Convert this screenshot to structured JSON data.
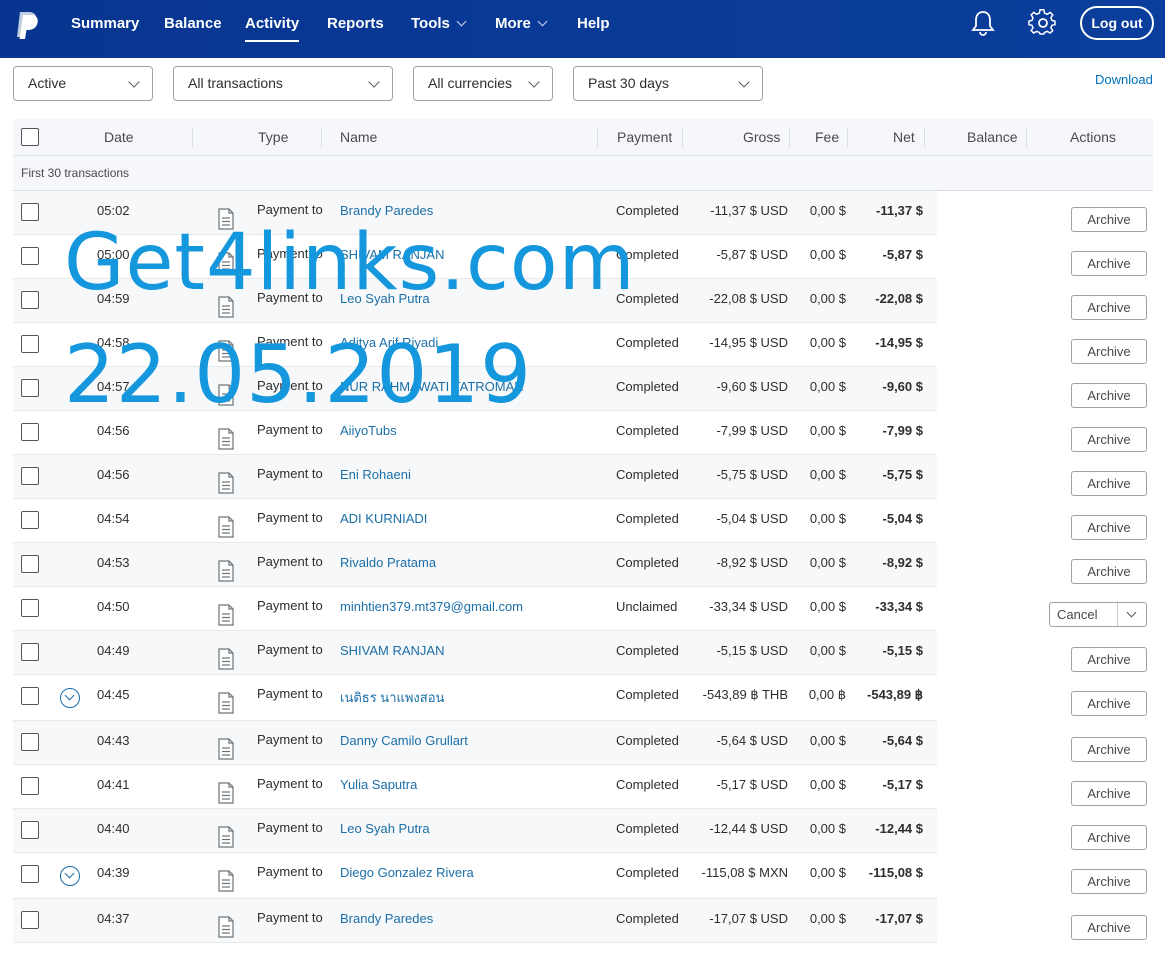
{
  "nav": {
    "items": [
      "Summary",
      "Balance",
      "Activity",
      "Reports",
      "Tools",
      "More",
      "Help"
    ],
    "active": "Activity",
    "logout_label": "Log out",
    "bell_icon": "bell-icon",
    "settings_icon": "gear-icon"
  },
  "filters": {
    "status": "Active",
    "type": "All transactions",
    "currency": "All currencies",
    "period": "Past 30 days",
    "download_label": "Download"
  },
  "table": {
    "headers": {
      "date": "Date",
      "type": "Type",
      "name": "Name",
      "payment": "Payment",
      "gross": "Gross",
      "fee": "Fee",
      "net": "Net",
      "balance": "Balance",
      "actions": "Actions"
    },
    "group_label": "First 30 transactions",
    "rows": [
      {
        "time": "05:02",
        "type": "Payment to",
        "name": "Brandy Paredes",
        "payment": "Completed",
        "gross": "-11,37 $ USD",
        "fee": "0,00 $",
        "net": "-11,37 $",
        "action": "Archive",
        "expand": false
      },
      {
        "time": "05:00",
        "type": "Payment to",
        "name": "SHIVAM RANJAN",
        "payment": "Completed",
        "gross": "-5,87 $ USD",
        "fee": "0,00 $",
        "net": "-5,87 $",
        "action": "Archive",
        "expand": false
      },
      {
        "time": "04:59",
        "type": "Payment to",
        "name": "Leo Syah Putra",
        "payment": "Completed",
        "gross": "-22,08 $ USD",
        "fee": "0,00 $",
        "net": "-22,08 $",
        "action": "Archive",
        "expand": false
      },
      {
        "time": "04:58",
        "type": "Payment to",
        "name": "Aditya Arif Riyadi",
        "payment": "Completed",
        "gross": "-14,95 $ USD",
        "fee": "0,00 $",
        "net": "-14,95 $",
        "action": "Archive",
        "expand": false
      },
      {
        "time": "04:57",
        "type": "Payment to",
        "name": "NUR RAHMAWATI TATROMAN",
        "payment": "Completed",
        "gross": "-9,60 $ USD",
        "fee": "0,00 $",
        "net": "-9,60 $",
        "action": "Archive",
        "expand": false
      },
      {
        "time": "04:56",
        "type": "Payment to",
        "name": "AiiyoTubs",
        "payment": "Completed",
        "gross": "-7,99 $ USD",
        "fee": "0,00 $",
        "net": "-7,99 $",
        "action": "Archive",
        "expand": false
      },
      {
        "time": "04:56",
        "type": "Payment to",
        "name": "Eni Rohaeni",
        "payment": "Completed",
        "gross": "-5,75 $ USD",
        "fee": "0,00 $",
        "net": "-5,75 $",
        "action": "Archive",
        "expand": false
      },
      {
        "time": "04:54",
        "type": "Payment to",
        "name": "ADI KURNIADI",
        "payment": "Completed",
        "gross": "-5,04 $ USD",
        "fee": "0,00 $",
        "net": "-5,04 $",
        "action": "Archive",
        "expand": false
      },
      {
        "time": "04:53",
        "type": "Payment to",
        "name": "Rivaldo Pratama",
        "payment": "Completed",
        "gross": "-8,92 $ USD",
        "fee": "0,00 $",
        "net": "-8,92 $",
        "action": "Archive",
        "expand": false
      },
      {
        "time": "04:50",
        "type": "Payment to",
        "name": "minhtien379.mt379@gmail.com",
        "payment": "Unclaimed",
        "gross": "-33,34 $ USD",
        "fee": "0,00 $",
        "net": "-33,34 $",
        "action": "Cancel",
        "expand": false
      },
      {
        "time": "04:49",
        "type": "Payment to",
        "name": "SHIVAM RANJAN",
        "payment": "Completed",
        "gross": "-5,15 $ USD",
        "fee": "0,00 $",
        "net": "-5,15 $",
        "action": "Archive",
        "expand": false
      },
      {
        "time": "04:45",
        "type": "Payment to",
        "name": "เนติธร นาแพงสอน",
        "payment": "Completed",
        "gross": "-543,89 ฿ THB",
        "fee": "0,00 ฿",
        "net": "-543,89 ฿",
        "action": "Archive",
        "expand": true
      },
      {
        "time": "04:43",
        "type": "Payment to",
        "name": "Danny Camilo Grullart",
        "payment": "Completed",
        "gross": "-5,64 $ USD",
        "fee": "0,00 $",
        "net": "-5,64 $",
        "action": "Archive",
        "expand": false
      },
      {
        "time": "04:41",
        "type": "Payment to",
        "name": "Yulia Saputra",
        "payment": "Completed",
        "gross": "-5,17 $ USD",
        "fee": "0,00 $",
        "net": "-5,17 $",
        "action": "Archive",
        "expand": false
      },
      {
        "time": "04:40",
        "type": "Payment to",
        "name": "Leo Syah Putra",
        "payment": "Completed",
        "gross": "-12,44 $ USD",
        "fee": "0,00 $",
        "net": "-12,44 $",
        "action": "Archive",
        "expand": false
      },
      {
        "time": "04:39",
        "type": "Payment to",
        "name": "Diego Gonzalez Rivera",
        "payment": "Completed",
        "gross": "-115,08 $ MXN",
        "fee": "0,00 $",
        "net": "-115,08 $",
        "action": "Archive",
        "expand": true
      },
      {
        "time": "04:37",
        "type": "Payment to",
        "name": "Brandy Paredes",
        "payment": "Completed",
        "gross": "-17,07 $ USD",
        "fee": "0,00 $",
        "net": "-17,07 $",
        "action": "Archive",
        "expand": false
      }
    ]
  },
  "watermark": {
    "line1": "Get4links.com",
    "line2": "22.05.2019"
  },
  "colors": {
    "nav_bg": "#0b3e9c",
    "link": "#1b6fa8",
    "watermark": "#1597dd"
  }
}
